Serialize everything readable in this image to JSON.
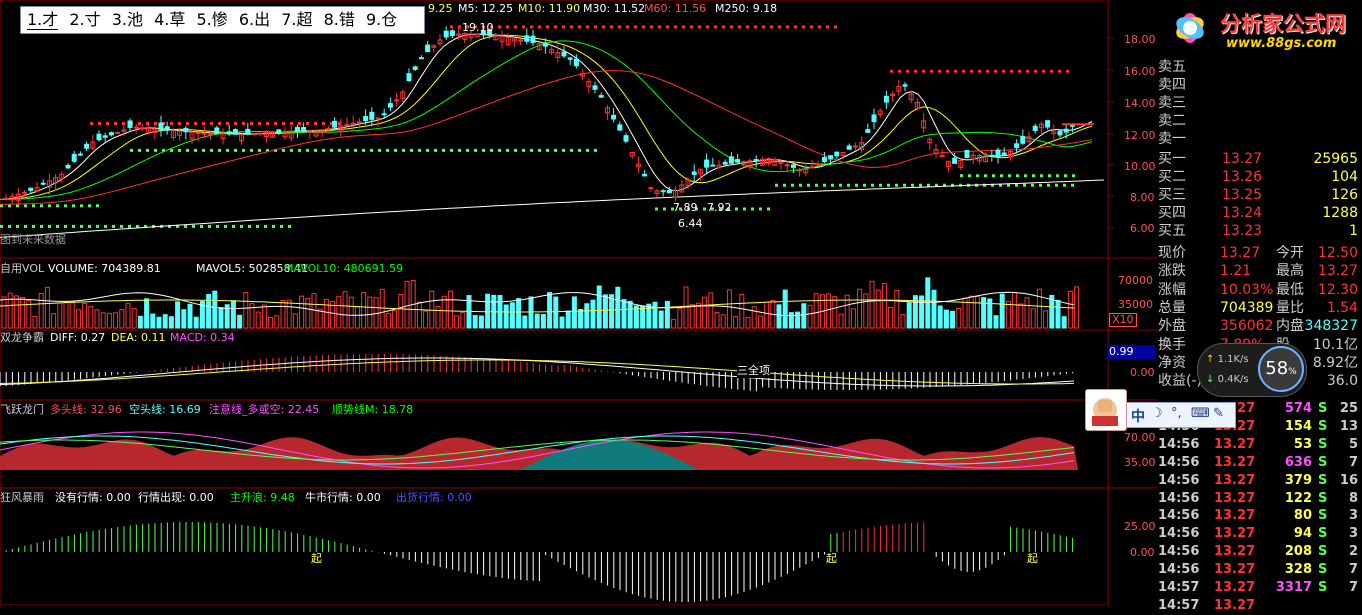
{
  "ime_candidates": [
    "1.才",
    "2.寸",
    "3.池",
    "4.草",
    "5.惨",
    "6.出",
    "7.超",
    "8.错",
    "9.仓"
  ],
  "ma_line": {
    "m5": "M5: 12.25",
    "m10": "M10: 11.90",
    "m30": "M30: 11.52",
    "m60": "M60: 11.56",
    "m250": "M250: 9.18",
    "prefix": "9.25"
  },
  "annotations": {
    "high": "19.10",
    "low_a": "7.89",
    "low_b": "7.92",
    "low": "6.44",
    "future": "图到未来数据",
    "sanquan": "三全项"
  },
  "price_axis": [
    "18.00",
    "16.00",
    "14.00",
    "12.00",
    "10.00",
    "8.00",
    "6.00"
  ],
  "vol": {
    "title": "自用VOL",
    "volume": "VOLUME: 704389.81",
    "mavol5": "MAVOL5: 502858.41",
    "mavol10": "MAVOL10: 480691.59",
    "axis": [
      "70000",
      "35000"
    ],
    "unit": "X10"
  },
  "macd": {
    "title": "双龙争霸",
    "diff": "DIFF: 0.27",
    "dea": "DEA: 0.11",
    "macd": "MACD: 0.34",
    "axis": [
      "0.00"
    ],
    "badge": "0.99"
  },
  "fly": {
    "title": "飞跃龙门",
    "bull": "多头线: 32.96",
    "bear": "空头线: 16.69",
    "note": "注意线_多或空: 22.45",
    "trend": "顺势线M: 18.78",
    "axis": [
      "70.00",
      "35.00"
    ]
  },
  "storm": {
    "title": "狂风暴雨",
    "none": "没有行情: 0.00",
    "appear": "行情出现: 0.00",
    "main": "主升浪: 9.48",
    "bull": "牛市行情: 0.00",
    "ship": "出货行情: 0.00",
    "axis": [
      "25.00",
      "0.00"
    ],
    "qi": "起"
  },
  "logo": {
    "text": "分析家公式网",
    "url": "www.88gs.com"
  },
  "sell": [
    {
      "label": "卖五"
    },
    {
      "label": "卖四"
    },
    {
      "label": "卖三"
    },
    {
      "label": "卖二"
    },
    {
      "label": "卖一"
    }
  ],
  "buy": [
    {
      "label": "买一",
      "price": "13.27",
      "vol": "25965"
    },
    {
      "label": "买二",
      "price": "13.26",
      "vol": "104"
    },
    {
      "label": "买三",
      "price": "13.25",
      "vol": "126"
    },
    {
      "label": "买四",
      "price": "13.24",
      "vol": "1288"
    },
    {
      "label": "买五",
      "price": "13.23",
      "vol": "1"
    }
  ],
  "quote": [
    {
      "l1": "现价",
      "v1": "13.27",
      "l2": "今开",
      "v2": "12.50"
    },
    {
      "l1": "涨跌",
      "v1": "1.21",
      "l2": "最高",
      "v2": "13.27"
    },
    {
      "l1": "涨幅",
      "v1": "10.03%",
      "l2": "最低",
      "v2": "12.30"
    },
    {
      "l1": "总量",
      "v1": "704389",
      "l2": "量比",
      "v2": "1.54"
    },
    {
      "l1": "外盘",
      "v1": "356062",
      "l2": "内盘",
      "v2": "348327"
    },
    {
      "l1": "换手",
      "v1": "7.89%",
      "l2": "股",
      "v2": "10.1亿"
    },
    {
      "l1": "净资",
      "v1": "",
      "l2": "",
      "v2": "8.92亿"
    },
    {
      "l1": "收益(-)",
      "v1": "",
      "l2": "",
      "v2": "36.0"
    }
  ],
  "speed": {
    "up": "1.1K/s",
    "down": "0.4K/s",
    "pct": "58"
  },
  "ime_bar": "中",
  "ticks": [
    {
      "t": "",
      "p": "13.27",
      "v": "574",
      "s": "S",
      "n": "25"
    },
    {
      "t": "14:56",
      "p": "13.27",
      "v": "154",
      "s": "S",
      "n": "13"
    },
    {
      "t": "14:56",
      "p": "13.27",
      "v": "53",
      "s": "S",
      "n": "5"
    },
    {
      "t": "14:56",
      "p": "13.27",
      "v": "636",
      "s": "S",
      "n": "7"
    },
    {
      "t": "14:56",
      "p": "13.27",
      "v": "379",
      "s": "S",
      "n": "16"
    },
    {
      "t": "14:56",
      "p": "13.27",
      "v": "122",
      "s": "S",
      "n": "8"
    },
    {
      "t": "14:56",
      "p": "13.27",
      "v": "80",
      "s": "S",
      "n": "3"
    },
    {
      "t": "14:56",
      "p": "13.27",
      "v": "94",
      "s": "S",
      "n": "3"
    },
    {
      "t": "14:56",
      "p": "13.27",
      "v": "208",
      "s": "S",
      "n": "2"
    },
    {
      "t": "14:56",
      "p": "13.27",
      "v": "328",
      "s": "S",
      "n": "7"
    },
    {
      "t": "14:57",
      "p": "13.27",
      "v": "3317",
      "s": "S",
      "n": "7"
    },
    {
      "t": "14:57",
      "p": "13.27",
      "v": "",
      "s": "",
      "n": ""
    }
  ],
  "colors": {
    "up": "#ff3232",
    "down": "#54ffff",
    "ma5": "#ffffff",
    "ma10": "#ffff00",
    "ma30": "#00ff00",
    "ma60": "#ff3030",
    "ma250": "#ffffff",
    "grid": "#8b0000"
  }
}
